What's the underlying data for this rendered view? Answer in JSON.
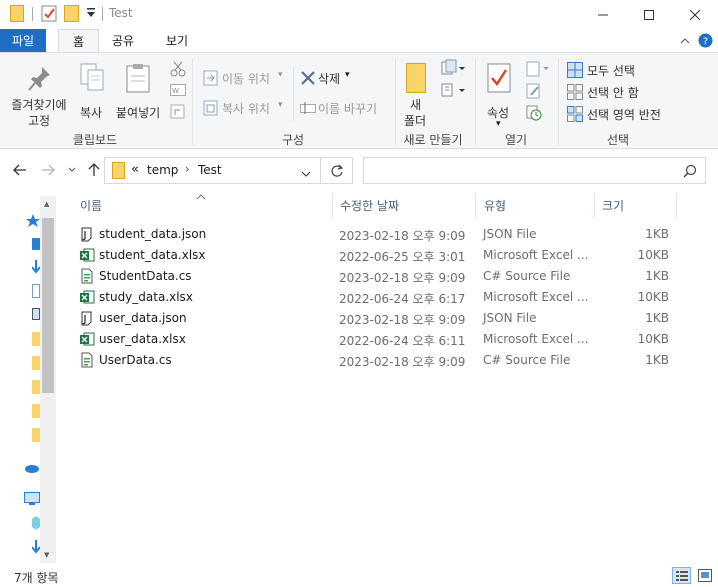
{
  "window": {
    "title": "Test"
  },
  "ribbon_tabs": [
    "파일",
    "홈",
    "공유",
    "보기"
  ],
  "ribbon": {
    "clipboard": {
      "pin_line1": "즐겨찾기에",
      "pin_line2": "고정",
      "copy": "복사",
      "paste": "붙여넣기",
      "label": "클립보드"
    },
    "organize": {
      "move_to": "이동 위치",
      "copy_to": "복사 위치",
      "delete": "삭제",
      "rename": "이름 바꾸기",
      "label": "구성"
    },
    "new": {
      "new_line1": "새",
      "new_line2": "폴더",
      "label": "새로 만들기"
    },
    "open": {
      "properties": "속성",
      "label": "열기"
    },
    "select": {
      "select_all": "모두 선택",
      "select_none": "선택 안 함",
      "invert": "선택 영역 반전",
      "label": "선택"
    }
  },
  "address": {
    "overflow": "«",
    "segments": [
      "temp",
      "Test"
    ],
    "separator": "›"
  },
  "columns": {
    "name": "이름",
    "date": "수정한 날짜",
    "type": "유형",
    "size": "크기"
  },
  "files": [
    {
      "name": "student_data.json",
      "date": "2023-02-18 오후 9:09",
      "type": "JSON File",
      "size": "1KB",
      "kind": "json"
    },
    {
      "name": "student_data.xlsx",
      "date": "2022-06-25 오후 3:01",
      "type": "Microsoft Excel ...",
      "size": "10KB",
      "kind": "xlsx"
    },
    {
      "name": "StudentData.cs",
      "date": "2023-02-18 오후 9:09",
      "type": "C# Source File",
      "size": "1KB",
      "kind": "cs"
    },
    {
      "name": "study_data.xlsx",
      "date": "2022-06-24 오후 6:17",
      "type": "Microsoft Excel ...",
      "size": "10KB",
      "kind": "xlsx"
    },
    {
      "name": "user_data.json",
      "date": "2023-02-18 오후 9:09",
      "type": "JSON File",
      "size": "1KB",
      "kind": "json"
    },
    {
      "name": "user_data.xlsx",
      "date": "2022-06-24 오후 6:11",
      "type": "Microsoft Excel ...",
      "size": "10KB",
      "kind": "xlsx"
    },
    {
      "name": "UserData.cs",
      "date": "2023-02-18 오후 9:09",
      "type": "C# Source File",
      "size": "1KB",
      "kind": "cs"
    }
  ],
  "status": {
    "count": "7개 항목"
  },
  "colors": {
    "accent": "#1e6ec6",
    "folder": "#f5c242",
    "excel": "#1f7244"
  }
}
